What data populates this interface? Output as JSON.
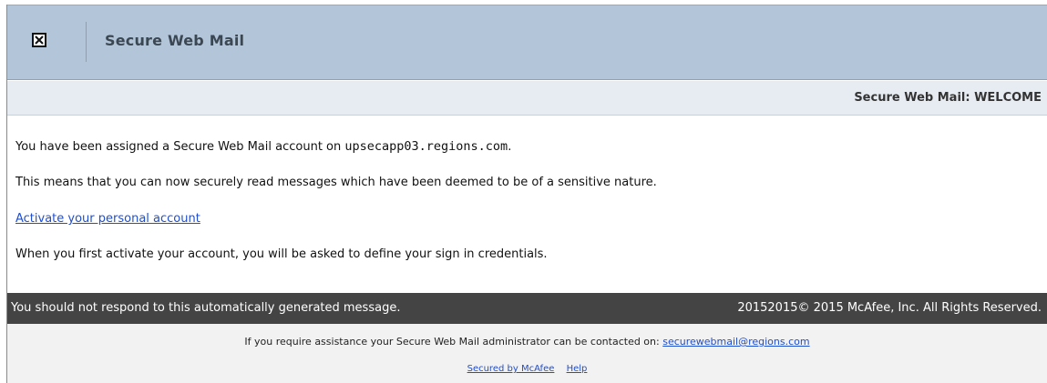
{
  "header": {
    "title": "Secure Web Mail",
    "logo_icon": "close-box-icon"
  },
  "subheader": {
    "title": "Secure Web Mail: WELCOME"
  },
  "content": {
    "line1_prefix": "You have been assigned a Secure Web Mail account on ",
    "line1_host": "upsecapp03.regions.com",
    "line1_suffix": ".",
    "line2": "This means that you can now securely read messages which have been deemed to be of a sensitive nature.",
    "activate_link": "Activate your personal account",
    "line4": "When you first activate your account, you will be asked to define your sign in credentials."
  },
  "footer": {
    "left": "You should not respond to this automatically generated message.",
    "right": "20152015© 2015 McAfee, Inc. All Rights Reserved."
  },
  "assist": {
    "text": "If you require assistance your Secure Web Mail administrator can be contacted on: ",
    "email": "securewebmail@regions.com",
    "secured_link": "Secured by McAfee",
    "help_link": "Help"
  },
  "colors": {
    "header_bg": "#b3c6d9",
    "subheader_bg": "#e7ecf2",
    "footer_bg": "#444444",
    "link": "#1f4fd1"
  }
}
